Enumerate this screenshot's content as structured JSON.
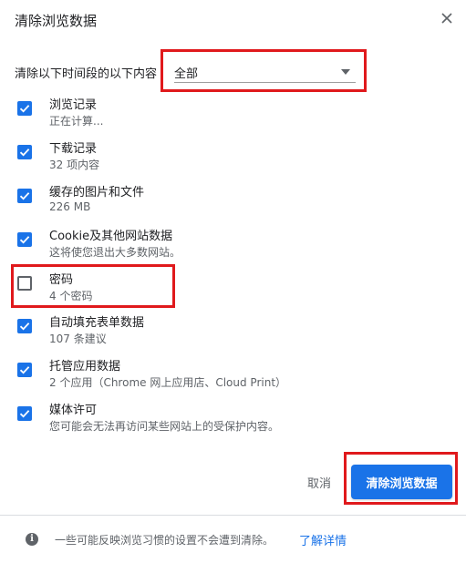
{
  "dialog": {
    "title": "清除浏览数据",
    "close_icon": "close-icon"
  },
  "time_range": {
    "label": "清除以下时间段的以下内容",
    "selected": "全部"
  },
  "items": [
    {
      "title": "浏览记录",
      "subtitle": "正在计算...",
      "checked": true
    },
    {
      "title": "下载记录",
      "subtitle": "32 项内容",
      "checked": true
    },
    {
      "title": "缓存的图片和文件",
      "subtitle": "226 MB",
      "checked": true
    },
    {
      "title": "Cookie及其他网站数据",
      "subtitle": "这将使您退出大多数网站。",
      "checked": true
    },
    {
      "title": "密码",
      "subtitle": "4 个密码",
      "checked": false
    },
    {
      "title": "自动填充表单数据",
      "subtitle": "107 条建议",
      "checked": true
    },
    {
      "title": "托管应用数据",
      "subtitle": "2 个应用（Chrome 网上应用店、Cloud Print）",
      "checked": true
    },
    {
      "title": "媒体许可",
      "subtitle": "您可能会无法再访问某些网站上的受保护内容。",
      "checked": true
    }
  ],
  "buttons": {
    "cancel": "取消",
    "confirm": "清除浏览数据"
  },
  "footer": {
    "text": "一些可能反映浏览习惯的设置不会遭到清除。",
    "link": "了解详情",
    "info_icon": "info-icon"
  },
  "colors": {
    "accent": "#1a73e8",
    "highlight": "#e0191c"
  }
}
